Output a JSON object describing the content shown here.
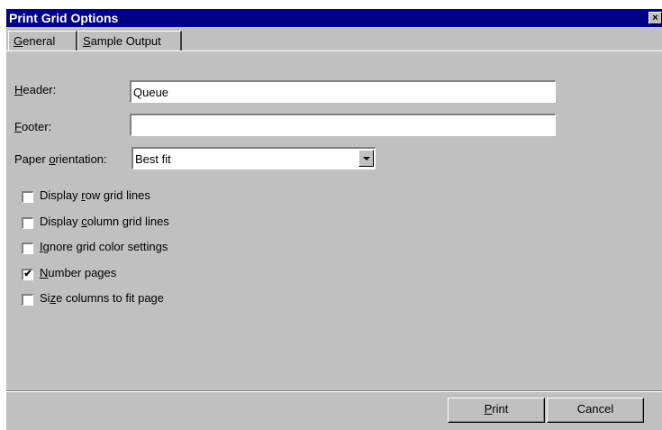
{
  "window": {
    "title": "Print Grid Options",
    "close_glyph": "×"
  },
  "tabs": [
    {
      "label_pre": "",
      "label_ul": "G",
      "label_post": "eneral",
      "active": true
    },
    {
      "label_pre": "",
      "label_ul": "S",
      "label_post": "ample Output",
      "active": false
    }
  ],
  "form": {
    "header": {
      "label_ul": "H",
      "label_post": "eader:",
      "value": "Queue"
    },
    "footer": {
      "label_ul": "F",
      "label_post": "ooter:",
      "value": ""
    },
    "orientation": {
      "label_pre": "Paper ",
      "label_ul": "o",
      "label_post": "rientation:",
      "value": "Best fit"
    }
  },
  "checkboxes": [
    {
      "pre": "Display ",
      "ul": "r",
      "post": "ow grid lines",
      "checked": false
    },
    {
      "pre": "Display ",
      "ul": "c",
      "post": "olumn grid lines",
      "checked": false
    },
    {
      "pre": "",
      "ul": "I",
      "post": "gnore grid color settings",
      "checked": false
    },
    {
      "pre": "",
      "ul": "N",
      "post": "umber pages",
      "checked": true
    },
    {
      "pre": "Si",
      "ul": "z",
      "post": "e columns to fit page",
      "checked": false
    }
  ],
  "check_mark": "✔",
  "buttons": {
    "print": {
      "ul": "P",
      "post": "rint"
    },
    "cancel": {
      "label": "Cancel"
    }
  }
}
